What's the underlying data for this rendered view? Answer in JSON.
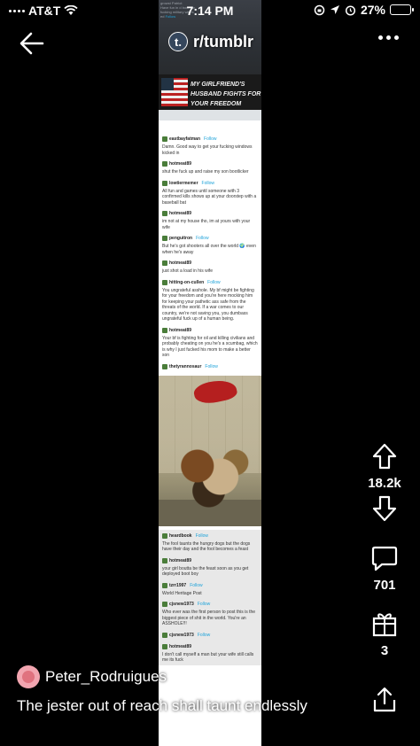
{
  "status_bar": {
    "carrier": "AT&T",
    "time": "7:14 PM",
    "battery_percent": "27%",
    "battery_level": 0.27
  },
  "header": {
    "subreddit_avatar_letter": "t.",
    "subreddit": "r/tumblr"
  },
  "post_image": {
    "header_fragments": [
      "growst",
      "Patriot",
      "Have fun in",
      "d bourbon",
      "fucking military wives",
      "ed",
      "Follow"
    ],
    "sticker_text": "MY GIRLFRIEND'S HUSBAND FIGHTS FOR YOUR FREEDOM",
    "comments_top": [
      {
        "user": "eastbayfatman",
        "follow": "Follow",
        "text": "Damn. Good way to get your fucking windows kicked in"
      },
      {
        "user": "hotmeat89",
        "follow": "",
        "text": "shut the fuck up and raise my son bootlicker"
      },
      {
        "user": "lowtiermemer",
        "follow": "Follow",
        "text": "All fun and games until someone with 3 confirmed kills shows up at your doorstep with a baseball bat"
      },
      {
        "user": "hotmeat89",
        "follow": "",
        "text": "im not at my house tho, im at yours with your wife"
      },
      {
        "user": "penguitron",
        "follow": "Follow",
        "text": "But he's got shooters all over the world 🌍 even when he's away"
      },
      {
        "user": "hotmeat89",
        "follow": "",
        "text": "just shot a load in his wife"
      },
      {
        "user": "hitting-on-cullen",
        "follow": "Follow",
        "text": "You ungrateful asshole. My bf might be fighting for your freedom and you're here mocking him for keeping your pathetic ass safe from the threats of the world. If a war comes to our country, we're not saving you, you dumbass ungrateful fuck up of a human being."
      },
      {
        "user": "hotmeat89",
        "follow": "",
        "text": "Your bf is fighting for oil and killing civilians and probably cheating on you he's a scumbag, which is why I just fucked his mom to make a better son"
      },
      {
        "user": "thetyrannosaur",
        "follow": "Follow",
        "text": ""
      }
    ],
    "comments_bottom": [
      {
        "user": "heardbook",
        "follow": "Follow",
        "text": "The fool taunts the hungry dogs but the dogs have their day and the fool becomes a feast"
      },
      {
        "user": "hotmeat89",
        "follow": "",
        "text": "your girl boutta be the feast soon as you get deployed boot boy"
      },
      {
        "user": "tzrr1997",
        "follow": "Follow",
        "text": "World Heritage Post"
      },
      {
        "user": "cjsnew1973",
        "follow": "Follow",
        "text": "Who ever was the first person to post this is the biggest piece of shit in the world. You're an ASSHOLE!!!"
      },
      {
        "user": "cjsnew1973",
        "follow": "Follow",
        "text": ""
      },
      {
        "user": "hotmeat89",
        "follow": "",
        "text": "I don't call myself a man but your wife still calls me its fuck"
      }
    ]
  },
  "actions": {
    "upvote_count": "18.2k",
    "comment_count": "701",
    "award_count": "3"
  },
  "post": {
    "author": "Peter_Rodruigues",
    "caption": "The jester out of reach shall taunt endlessly"
  },
  "colors": {
    "background": "#000000",
    "text": "#ffffff",
    "tumblr_follow": "#1fa3d9",
    "jester_red": "#b51f1f"
  }
}
